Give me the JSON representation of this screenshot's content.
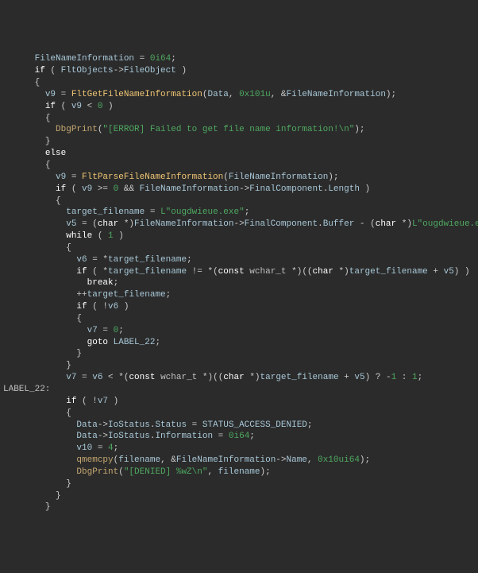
{
  "code": {
    "lines": [
      {
        "indent": 3,
        "tokens": [
          {
            "t": "gv",
            "v": "FileNameInformation"
          },
          {
            "t": "op",
            "v": " = "
          },
          {
            "t": "num",
            "v": "0i64"
          },
          {
            "t": "op",
            "v": ";"
          }
        ]
      },
      {
        "indent": 3,
        "tokens": [
          {
            "t": "kw",
            "v": "if"
          },
          {
            "t": "op",
            "v": " ( "
          },
          {
            "t": "gv",
            "v": "FltObjects"
          },
          {
            "t": "op",
            "v": "->"
          },
          {
            "t": "member",
            "v": "FileObject"
          },
          {
            "t": "op",
            "v": " )"
          }
        ]
      },
      {
        "indent": 3,
        "tokens": [
          {
            "t": "op",
            "v": "{"
          }
        ]
      },
      {
        "indent": 4,
        "tokens": [
          {
            "t": "gv",
            "v": "v9"
          },
          {
            "t": "op",
            "v": " = "
          },
          {
            "t": "fn",
            "v": "FltGetFileNameInformation"
          },
          {
            "t": "op",
            "v": "("
          },
          {
            "t": "gv",
            "v": "Data"
          },
          {
            "t": "op",
            "v": ", "
          },
          {
            "t": "num",
            "v": "0x101u"
          },
          {
            "t": "op",
            "v": ", &"
          },
          {
            "t": "gv",
            "v": "FileNameInformation"
          },
          {
            "t": "op",
            "v": ");"
          }
        ]
      },
      {
        "indent": 4,
        "tokens": [
          {
            "t": "kw",
            "v": "if"
          },
          {
            "t": "op",
            "v": " ( "
          },
          {
            "t": "gv",
            "v": "v9"
          },
          {
            "t": "op",
            "v": " < "
          },
          {
            "t": "num",
            "v": "0"
          },
          {
            "t": "op",
            "v": " )"
          }
        ]
      },
      {
        "indent": 4,
        "tokens": [
          {
            "t": "op",
            "v": "{"
          }
        ]
      },
      {
        "indent": 5,
        "tokens": [
          {
            "t": "fncall",
            "v": "DbgPrint"
          },
          {
            "t": "op",
            "v": "("
          },
          {
            "t": "str",
            "v": "\"[ERROR] Failed to get file name information!\\n\""
          },
          {
            "t": "op",
            "v": ");"
          }
        ]
      },
      {
        "indent": 4,
        "tokens": [
          {
            "t": "op",
            "v": "}"
          }
        ]
      },
      {
        "indent": 4,
        "tokens": [
          {
            "t": "kw",
            "v": "else"
          }
        ]
      },
      {
        "indent": 4,
        "tokens": [
          {
            "t": "op",
            "v": "{"
          }
        ]
      },
      {
        "indent": 5,
        "tokens": [
          {
            "t": "gv",
            "v": "v9"
          },
          {
            "t": "op",
            "v": " = "
          },
          {
            "t": "fn",
            "v": "FltParseFileNameInformation"
          },
          {
            "t": "op",
            "v": "("
          },
          {
            "t": "gv",
            "v": "FileNameInformation"
          },
          {
            "t": "op",
            "v": ");"
          }
        ]
      },
      {
        "indent": 5,
        "tokens": [
          {
            "t": "kw",
            "v": "if"
          },
          {
            "t": "op",
            "v": " ( "
          },
          {
            "t": "gv",
            "v": "v9"
          },
          {
            "t": "op",
            "v": " >= "
          },
          {
            "t": "num",
            "v": "0"
          },
          {
            "t": "op",
            "v": " && "
          },
          {
            "t": "gv",
            "v": "FileNameInformation"
          },
          {
            "t": "op",
            "v": "->"
          },
          {
            "t": "member",
            "v": "FinalComponent"
          },
          {
            "t": "op",
            "v": "."
          },
          {
            "t": "member",
            "v": "Length"
          },
          {
            "t": "op",
            "v": " )"
          }
        ]
      },
      {
        "indent": 5,
        "tokens": [
          {
            "t": "op",
            "v": "{"
          }
        ]
      },
      {
        "indent": 6,
        "tokens": [
          {
            "t": "gv",
            "v": "target_filename"
          },
          {
            "t": "op",
            "v": " = "
          },
          {
            "t": "str",
            "v": "L\"ougdwieue.exe\""
          },
          {
            "t": "op",
            "v": ";"
          }
        ]
      },
      {
        "indent": 6,
        "tokens": [
          {
            "t": "gv",
            "v": "v5"
          },
          {
            "t": "op",
            "v": " = ("
          },
          {
            "t": "kw",
            "v": "char"
          },
          {
            "t": "op",
            "v": " *)"
          },
          {
            "t": "gv",
            "v": "FileNameInformation"
          },
          {
            "t": "op",
            "v": "->"
          },
          {
            "t": "member",
            "v": "FinalComponent"
          },
          {
            "t": "op",
            "v": "."
          },
          {
            "t": "member",
            "v": "Buffer"
          },
          {
            "t": "op",
            "v": " - ("
          },
          {
            "t": "kw",
            "v": "char"
          },
          {
            "t": "op",
            "v": " *)"
          },
          {
            "t": "str",
            "v": "L\"ougdwieue.exe\""
          },
          {
            "t": "op",
            "v": ";"
          }
        ]
      },
      {
        "indent": 6,
        "tokens": [
          {
            "t": "kw",
            "v": "while"
          },
          {
            "t": "op",
            "v": " ( "
          },
          {
            "t": "num",
            "v": "1"
          },
          {
            "t": "op",
            "v": " )"
          }
        ]
      },
      {
        "indent": 6,
        "tokens": [
          {
            "t": "op",
            "v": "{"
          }
        ]
      },
      {
        "indent": 7,
        "tokens": [
          {
            "t": "gv",
            "v": "v6"
          },
          {
            "t": "op",
            "v": " = *"
          },
          {
            "t": "gv",
            "v": "target_filename"
          },
          {
            "t": "op",
            "v": ";"
          }
        ]
      },
      {
        "indent": 7,
        "tokens": [
          {
            "t": "kw",
            "v": "if"
          },
          {
            "t": "op",
            "v": " ( *"
          },
          {
            "t": "gv",
            "v": "target_filename"
          },
          {
            "t": "op",
            "v": " != *("
          },
          {
            "t": "kw",
            "v": "const"
          },
          {
            "t": "op",
            "v": " "
          },
          {
            "t": "type",
            "v": "wchar_t"
          },
          {
            "t": "op",
            "v": " *)(("
          },
          {
            "t": "kw",
            "v": "char"
          },
          {
            "t": "op",
            "v": " *)"
          },
          {
            "t": "gv",
            "v": "target_filename"
          },
          {
            "t": "op",
            "v": " + "
          },
          {
            "t": "gv",
            "v": "v5"
          },
          {
            "t": "op",
            "v": ") )"
          }
        ]
      },
      {
        "indent": 8,
        "tokens": [
          {
            "t": "kw",
            "v": "break"
          },
          {
            "t": "op",
            "v": ";"
          }
        ]
      },
      {
        "indent": 7,
        "tokens": [
          {
            "t": "op",
            "v": "++"
          },
          {
            "t": "gv",
            "v": "target_filename"
          },
          {
            "t": "op",
            "v": ";"
          }
        ]
      },
      {
        "indent": 7,
        "tokens": [
          {
            "t": "kw",
            "v": "if"
          },
          {
            "t": "op",
            "v": " ( !"
          },
          {
            "t": "gv",
            "v": "v6"
          },
          {
            "t": "op",
            "v": " )"
          }
        ]
      },
      {
        "indent": 7,
        "tokens": [
          {
            "t": "op",
            "v": "{"
          }
        ]
      },
      {
        "indent": 8,
        "tokens": [
          {
            "t": "gv",
            "v": "v7"
          },
          {
            "t": "op",
            "v": " = "
          },
          {
            "t": "num",
            "v": "0"
          },
          {
            "t": "op",
            "v": ";"
          }
        ]
      },
      {
        "indent": 8,
        "tokens": [
          {
            "t": "kw",
            "v": "goto"
          },
          {
            "t": "op",
            "v": " "
          },
          {
            "t": "gv",
            "v": "LABEL_22"
          },
          {
            "t": "op",
            "v": ";"
          }
        ]
      },
      {
        "indent": 7,
        "tokens": [
          {
            "t": "op",
            "v": "}"
          }
        ]
      },
      {
        "indent": 6,
        "tokens": [
          {
            "t": "op",
            "v": "}"
          }
        ]
      },
      {
        "indent": 6,
        "tokens": [
          {
            "t": "gv",
            "v": "v7"
          },
          {
            "t": "op",
            "v": " = "
          },
          {
            "t": "gv",
            "v": "v6"
          },
          {
            "t": "op",
            "v": " < *("
          },
          {
            "t": "kw",
            "v": "const"
          },
          {
            "t": "op",
            "v": " "
          },
          {
            "t": "type",
            "v": "wchar_t"
          },
          {
            "t": "op",
            "v": " *)(("
          },
          {
            "t": "kw",
            "v": "char"
          },
          {
            "t": "op",
            "v": " *)"
          },
          {
            "t": "gv",
            "v": "target_filename"
          },
          {
            "t": "op",
            "v": " + "
          },
          {
            "t": "gv",
            "v": "v5"
          },
          {
            "t": "op",
            "v": ") ? -"
          },
          {
            "t": "num",
            "v": "1"
          },
          {
            "t": "op",
            "v": " : "
          },
          {
            "t": "num",
            "v": "1"
          },
          {
            "t": "op",
            "v": ";"
          }
        ]
      },
      {
        "indent": 0,
        "tokens": [
          {
            "t": "label",
            "v": "LABEL_22:"
          }
        ]
      },
      {
        "indent": 6,
        "tokens": [
          {
            "t": "kw",
            "v": "if"
          },
          {
            "t": "op",
            "v": " ( !"
          },
          {
            "t": "gv",
            "v": "v7"
          },
          {
            "t": "op",
            "v": " )"
          }
        ]
      },
      {
        "indent": 6,
        "tokens": [
          {
            "t": "op",
            "v": "{"
          }
        ]
      },
      {
        "indent": 7,
        "tokens": [
          {
            "t": "gv",
            "v": "Data"
          },
          {
            "t": "op",
            "v": "->"
          },
          {
            "t": "member",
            "v": "IoStatus"
          },
          {
            "t": "op",
            "v": "."
          },
          {
            "t": "member",
            "v": "Status"
          },
          {
            "t": "op",
            "v": " = "
          },
          {
            "t": "gconst",
            "v": "STATUS_ACCESS_DENIED"
          },
          {
            "t": "op",
            "v": ";"
          }
        ]
      },
      {
        "indent": 7,
        "tokens": [
          {
            "t": "gv",
            "v": "Data"
          },
          {
            "t": "op",
            "v": "->"
          },
          {
            "t": "member",
            "v": "IoStatus"
          },
          {
            "t": "op",
            "v": "."
          },
          {
            "t": "member",
            "v": "Information"
          },
          {
            "t": "op",
            "v": " = "
          },
          {
            "t": "num",
            "v": "0i64"
          },
          {
            "t": "op",
            "v": ";"
          }
        ]
      },
      {
        "indent": 7,
        "tokens": [
          {
            "t": "gv",
            "v": "v10"
          },
          {
            "t": "op",
            "v": " = "
          },
          {
            "t": "num",
            "v": "4"
          },
          {
            "t": "op",
            "v": ";"
          }
        ]
      },
      {
        "indent": 7,
        "tokens": [
          {
            "t": "fncall",
            "v": "qmemcpy"
          },
          {
            "t": "op",
            "v": "("
          },
          {
            "t": "gv",
            "v": "filename"
          },
          {
            "t": "op",
            "v": ", &"
          },
          {
            "t": "gv",
            "v": "FileNameInformation"
          },
          {
            "t": "op",
            "v": "->"
          },
          {
            "t": "member",
            "v": "Name"
          },
          {
            "t": "op",
            "v": ", "
          },
          {
            "t": "num",
            "v": "0x10ui64"
          },
          {
            "t": "op",
            "v": ");"
          }
        ]
      },
      {
        "indent": 7,
        "tokens": [
          {
            "t": "fncall",
            "v": "DbgPrint"
          },
          {
            "t": "op",
            "v": "("
          },
          {
            "t": "str",
            "v": "\"[DENIED] %wZ\\n\""
          },
          {
            "t": "op",
            "v": ", "
          },
          {
            "t": "gv",
            "v": "filename"
          },
          {
            "t": "op",
            "v": ");"
          }
        ]
      },
      {
        "indent": 6,
        "tokens": [
          {
            "t": "op",
            "v": "}"
          }
        ]
      },
      {
        "indent": 5,
        "tokens": [
          {
            "t": "op",
            "v": "}"
          }
        ]
      },
      {
        "indent": 4,
        "tokens": [
          {
            "t": "op",
            "v": "}"
          }
        ]
      }
    ]
  }
}
